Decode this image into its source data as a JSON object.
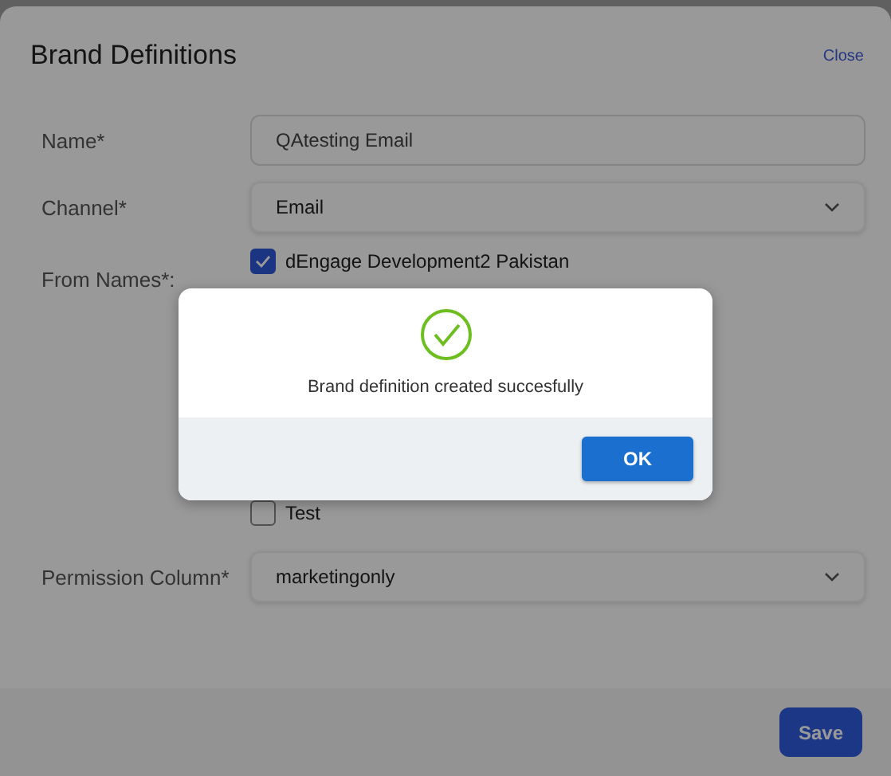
{
  "dialog": {
    "title": "Brand Definitions",
    "close": "Close",
    "fields": [
      {
        "kind": "text",
        "label": "Name*",
        "value": "QAtesting Email"
      },
      {
        "kind": "select",
        "label": "Channel*",
        "value": "Email"
      },
      {
        "kind": "checklist",
        "label": "From Names*:",
        "options": [
          {
            "label": "dEngage Development2 Pakistan",
            "checked": true
          },
          {
            "label": "Test",
            "checked": false
          }
        ]
      },
      {
        "kind": "select",
        "label": "Permission Column*",
        "value": "marketingonly"
      }
    ],
    "save": "Save"
  },
  "alert": {
    "message": "Brand definition created succesfully",
    "ok": "OK"
  }
}
